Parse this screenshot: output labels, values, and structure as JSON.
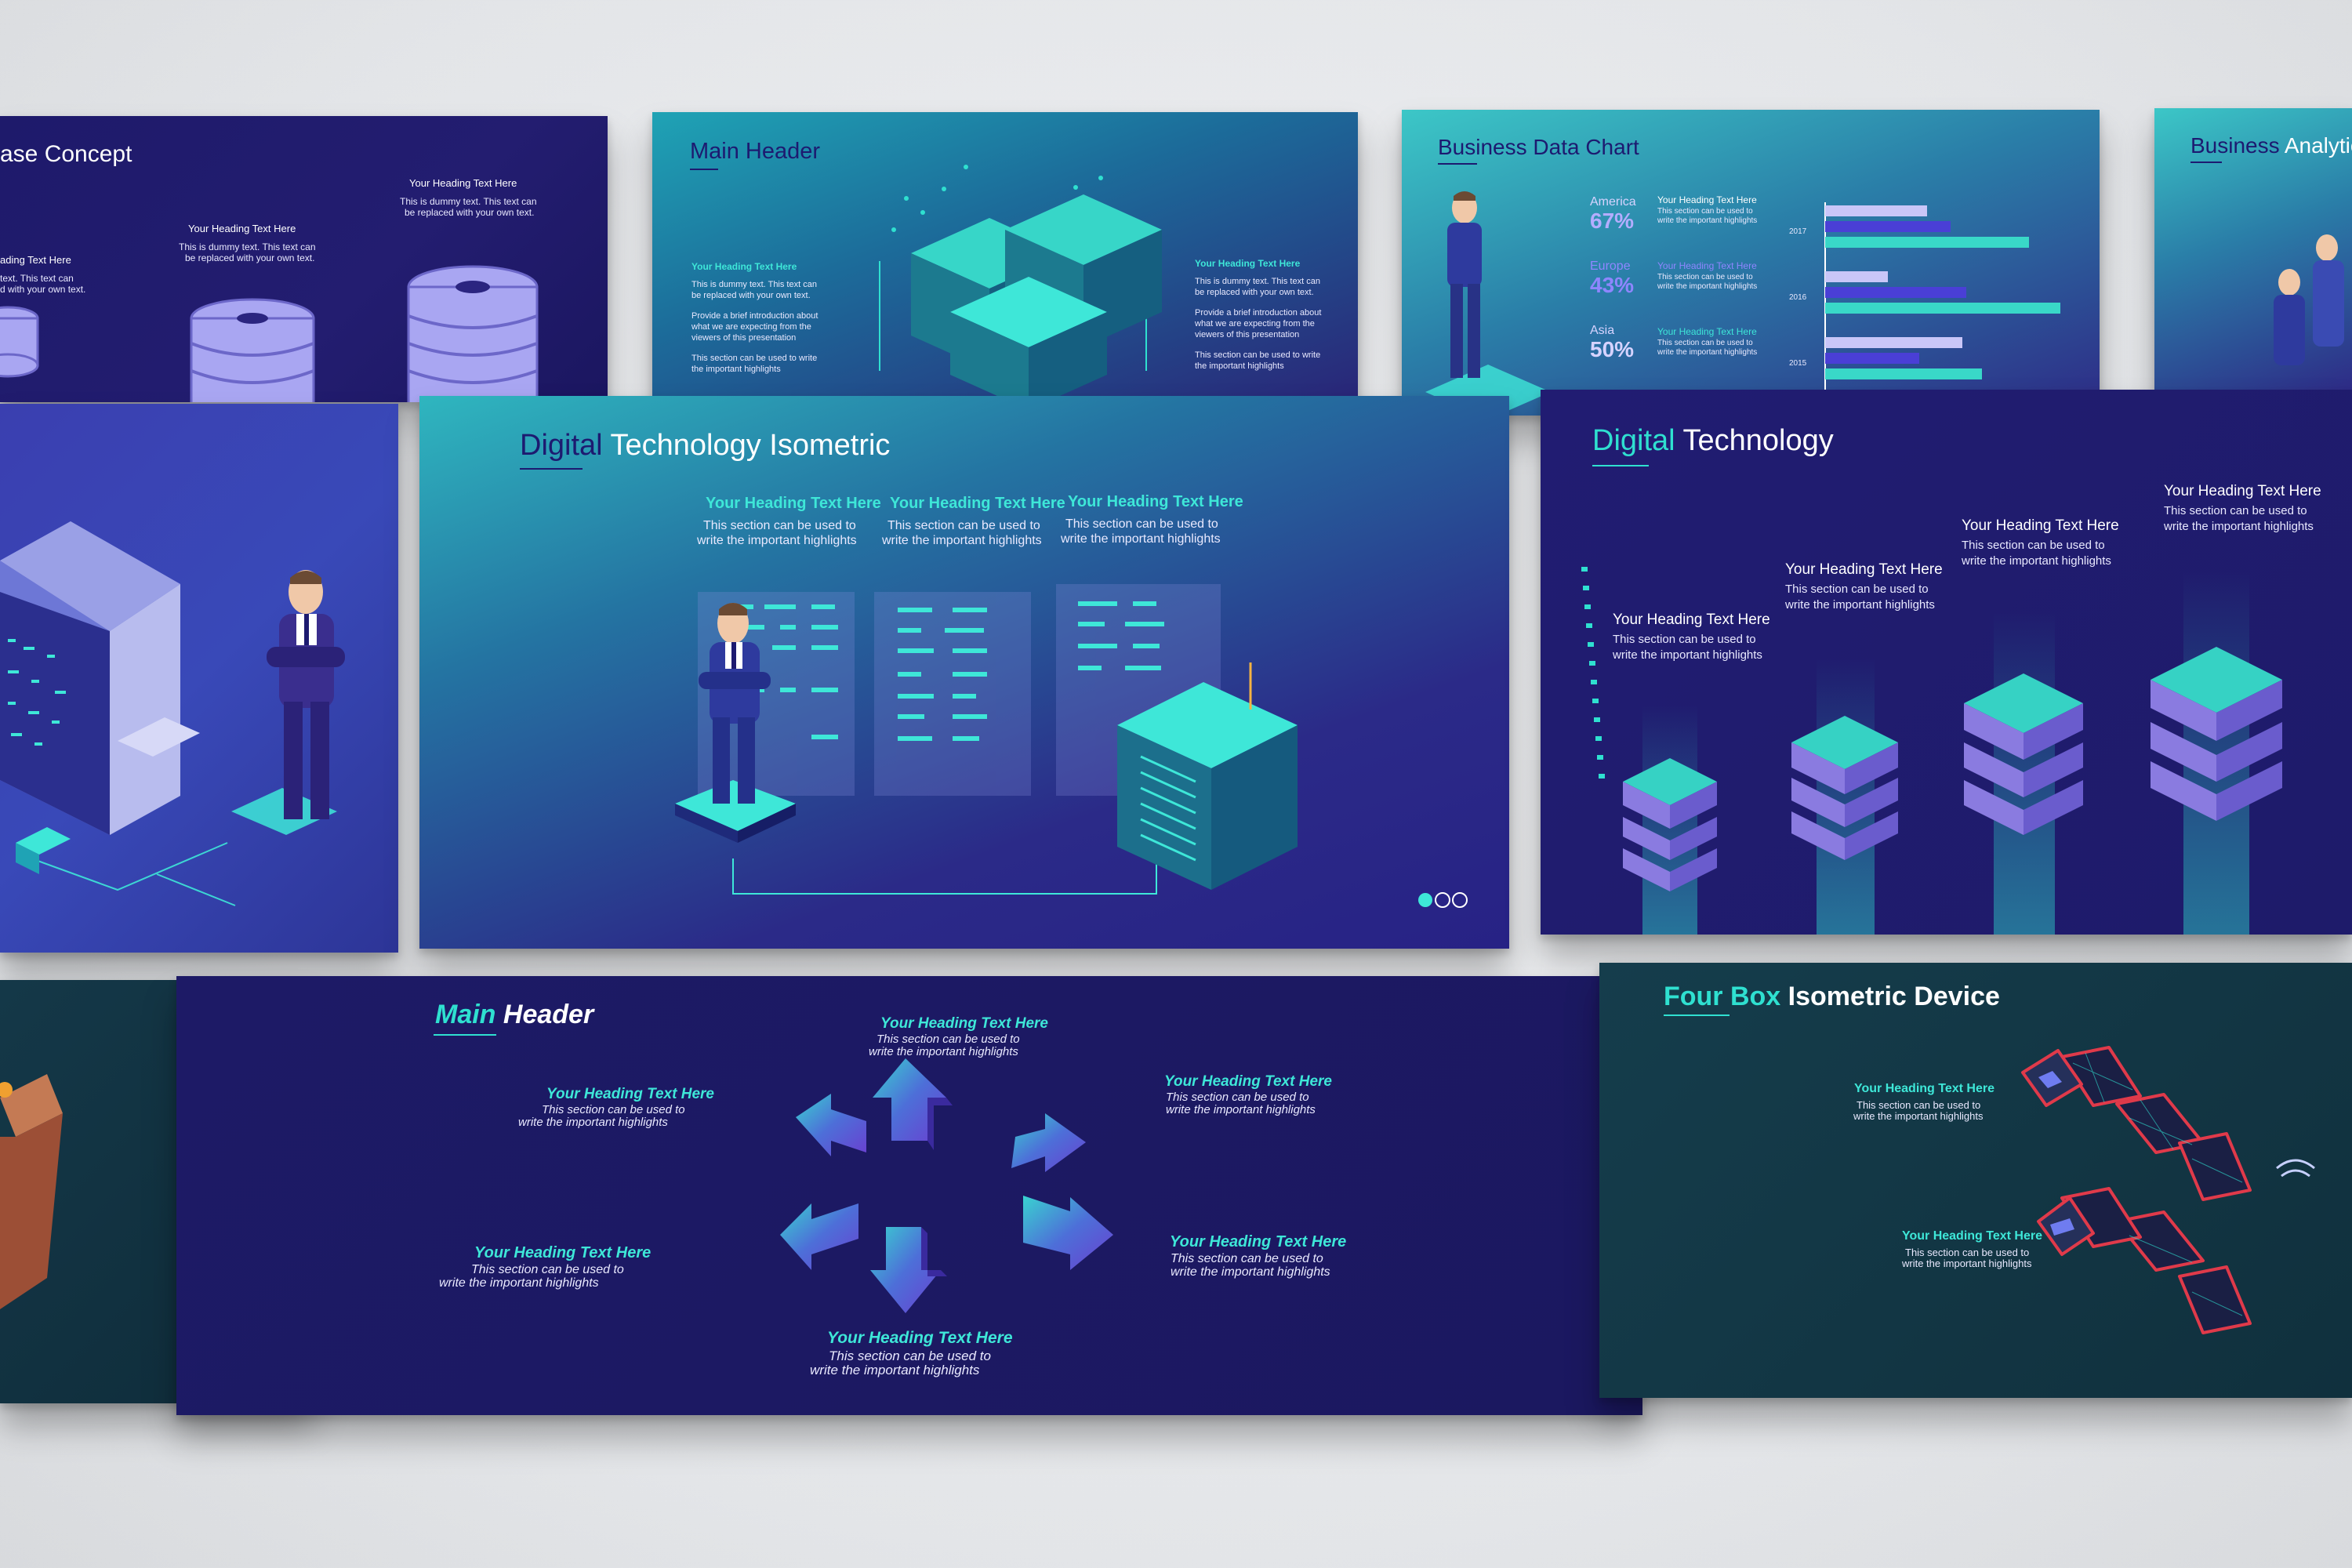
{
  "s1": {
    "title_a": "ase Concept",
    "h1": "Your Heading Text Here",
    "t1a": "This is dummy text. This text can",
    "t1b": "be replaced with your own text.",
    "h2": "Your Heading Text Here",
    "t2a": "This is dummy text. This text can",
    "t2b": "be replaced with your own text.",
    "h3": "ading Text Here",
    "t3a": "text. This text can",
    "t3b": "d with your own text."
  },
  "s2": {
    "title_a": "Main",
    "title_b": "Header",
    "hl": "Your Heading Text Here",
    "l1": "This is dummy text. This text can",
    "l2": "be replaced with your own text.",
    "l3": "Provide a brief introduction about",
    "l4": "what we are expecting from the",
    "l5": "viewers of this presentation",
    "l6": "This section can be used to write",
    "l7": "the important highlights",
    "hr": "Your Heading Text Here",
    "r1": "This is dummy text. This text can",
    "r2": "be replaced with your own text.",
    "r3": "Provide a brief introduction about",
    "r4": "what we are expecting from the",
    "r5": "viewers of this presentation",
    "r6": "This section can be used to write",
    "r7": "the important highlights"
  },
  "s3": {
    "title_a": "Business",
    "title_b": "Data Chart",
    "rows": [
      {
        "region": "America",
        "pct": "67%",
        "head": "Your Heading Text Here",
        "t1": "This section can be used to",
        "t2": "write the important highlights",
        "year": "2017"
      },
      {
        "region": "Europe",
        "pct": "43%",
        "head": "Your Heading Text Here",
        "t1": "This section can be used to",
        "t2": "write the important highlights",
        "year": "2016"
      },
      {
        "region": "Asia",
        "pct": "50%",
        "head": "Your Heading Text Here",
        "t1": "This section can be used to",
        "t2": "write the important highlights",
        "year": "2015"
      }
    ]
  },
  "s4": {
    "title_a": "Business",
    "title_b": "Analytics"
  },
  "s6": {
    "title_a": "Digital",
    "title_b": "Technology Isometric",
    "cols": [
      {
        "head": "Your Heading Text Here",
        "t1": "This section can be used to",
        "t2": "write the important highlights"
      },
      {
        "head": "Your Heading Text Here",
        "t1": "This section can be used to",
        "t2": "write the important highlights"
      },
      {
        "head": "Your Heading Text Here",
        "t1": "This section can be used to",
        "t2": "write the important highlights"
      }
    ]
  },
  "s7": {
    "title_a": "Digital",
    "title_b": "Technology",
    "cols": [
      {
        "head": "Your Heading Text Here",
        "t1": "This section can be used to",
        "t2": "write the important highlights"
      },
      {
        "head": "Your Heading Text Here",
        "t1": "This section can be used to",
        "t2": "write the important highlights"
      },
      {
        "head": "Your Heading Text Here",
        "t1": "This section can be used to",
        "t2": "write the important highlights"
      },
      {
        "head": "Your Heading Text Here",
        "t1": "This section can be used to",
        "t2": "write the important highlights"
      }
    ]
  },
  "s9": {
    "title_a": "Main",
    "title_b": "Header",
    "items": [
      {
        "head": "Your Heading Text Here",
        "t1": "This section can be used to",
        "t2": "write the important highlights"
      },
      {
        "head": "Your Heading Text Here",
        "t1": "This section can be used to",
        "t2": "write the important highlights"
      },
      {
        "head": "Your Heading Text Here",
        "t1": "This section can be used to",
        "t2": "write the important highlights"
      },
      {
        "head": "Your Heading Text Here",
        "t1": "This section can be used to",
        "t2": "write the important highlights"
      },
      {
        "head": "Your Heading Text Here",
        "t1": "This section can be used to",
        "t2": "write the important highlights"
      },
      {
        "head": "Your Heading Text Here",
        "t1": "This section can be used to",
        "t2": "write the important highlights"
      }
    ]
  },
  "s10": {
    "title_a": "Four Box",
    "title_b": "Isometric Device",
    "items": [
      {
        "head": "Your Heading Text Here",
        "t1": "This section can be used to",
        "t2": "write the important highlights"
      },
      {
        "head": "Your Heading Text Here",
        "t1": "This section can be used to",
        "t2": "write the important highlights"
      }
    ]
  },
  "colors": {
    "accent": "#2fe0d0",
    "navy": "#1e1a6b",
    "violet": "#8f86ff"
  }
}
